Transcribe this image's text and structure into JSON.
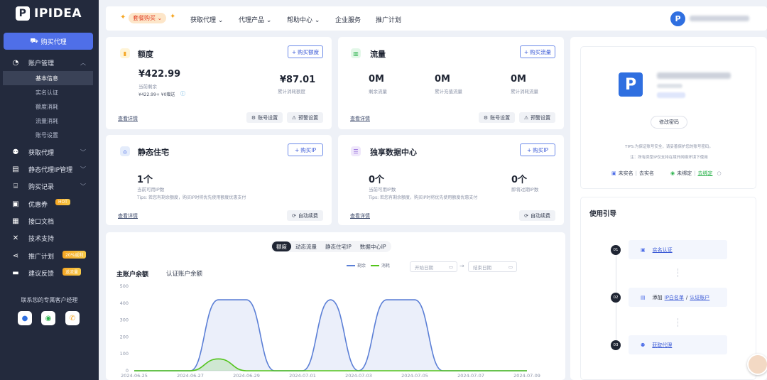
{
  "brand": {
    "name": "IPIDEA"
  },
  "sidebar": {
    "buy_label": "购买代理",
    "items": [
      {
        "label": "账户管理",
        "icon": "pie-chart-icon"
      },
      {
        "label": "获取代理",
        "icon": "user-download-icon"
      },
      {
        "label": "静态代理IP管理",
        "icon": "ticket-icon"
      },
      {
        "label": "购买记录",
        "icon": "gift-icon"
      },
      {
        "label": "优惠券",
        "icon": "coupon-icon",
        "badge": "HOT"
      },
      {
        "label": "接口文档",
        "icon": "doc-icon"
      },
      {
        "label": "技术支持",
        "icon": "wrench-icon"
      },
      {
        "label": "推广计划",
        "icon": "share-icon",
        "badge": "20%返利"
      },
      {
        "label": "建议反馈",
        "icon": "chat-icon",
        "badge": "送流量"
      }
    ],
    "subitems": [
      "基本信息",
      "实名认证",
      "额度消耗",
      "流量消耗",
      "账号设置"
    ],
    "manager_title": "联系您的专属客户经理"
  },
  "topbar": {
    "promo": "套餐购买",
    "nav": [
      "获取代理",
      "代理产品",
      "帮助中心",
      "企业服务",
      "推广计划"
    ]
  },
  "quota_card": {
    "title": "额度",
    "buy": "购买额度",
    "amount": "¥422.99",
    "amount_label": "当前剩余",
    "amount_detail": "¥422.99+ ¥0赠送",
    "consumed": "¥87.01",
    "consumed_label": "累计消耗额度",
    "details": "查看详情",
    "account_settings": "账号设置",
    "alert_settings": "预警设置"
  },
  "traffic_card": {
    "title": "流量",
    "buy": "购买流量",
    "values": [
      {
        "value": "0M",
        "label": "剩余流量"
      },
      {
        "value": "0M",
        "label": "累计充值流量"
      },
      {
        "value": "0M",
        "label": "累计消耗流量"
      }
    ],
    "details": "查看详情",
    "account_settings": "账号设置",
    "alert_settings": "预警设置"
  },
  "static_card": {
    "title": "静态住宅",
    "buy": "购买IP",
    "count": "1个",
    "count_label": "当前可用IP数",
    "tips": "Tips: 若您有剩余额度，购买IP时将优先使用额度优惠支付",
    "details": "查看详情",
    "auto_renew": "自动续费"
  },
  "dc_card": {
    "title": "独享数据中心",
    "buy": "购买IP",
    "count": "0个",
    "count_label": "当前可用IP数",
    "expiring": "0个",
    "expiring_label": "即将过期IP数",
    "tips": "Tips: 若您有剩余额度，购买IP时将优先使用额度优惠支付",
    "details": "查看详情",
    "auto_renew": "自动续费"
  },
  "chart_panel": {
    "tabs": [
      "额度",
      "动态流量",
      "静态住宅IP",
      "数据中心IP"
    ],
    "active_tab": "额度",
    "subtabs": [
      "主账户余额",
      "认证账户余额"
    ],
    "start_date": "开始日期",
    "end_date": "结束日期"
  },
  "chart_data": {
    "type": "area",
    "x": [
      "2024-06-25",
      "2024-06-26",
      "2024-06-27",
      "2024-06-28",
      "2024-06-29",
      "2024-06-30",
      "2024-07-01",
      "2024-07-02",
      "2024-07-03",
      "2024-07-04",
      "2024-07-05",
      "2024-07-06",
      "2024-07-07",
      "2024-07-08",
      "2024-07-09"
    ],
    "x_ticks": [
      "2024-06-25",
      "2024-06-27",
      "2024-06-29",
      "2024-07-01",
      "2024-07-03",
      "2024-07-05",
      "2024-07-07",
      "2024-07-09"
    ],
    "ylim": [
      0,
      500
    ],
    "yticks": [
      0,
      100,
      200,
      300,
      400,
      500
    ],
    "series": [
      {
        "name": "剩余",
        "color": "#5b7fd6",
        "values": [
          0,
          0,
          0,
          420,
          420,
          0,
          0,
          420,
          0,
          420,
          420,
          0,
          0,
          0,
          0
        ]
      },
      {
        "name": "消耗",
        "color": "#52c41a",
        "values": [
          0,
          0,
          0,
          70,
          0,
          0,
          0,
          0,
          0,
          0,
          0,
          0,
          0,
          0,
          0
        ]
      }
    ],
    "legend": "top-right"
  },
  "profile": {
    "edit_password": "修改密码",
    "tips": "TIPS:为保证账号安全，请妥善保护您的账号密码。",
    "note": "注：所有类型IP仅支持在境外网络环境下使用",
    "unverified": "未实名",
    "go_verify": "去实名",
    "unbound": "未绑定",
    "go_bind": "去绑定"
  },
  "guide": {
    "title": "使用引导",
    "steps": [
      {
        "num": "01",
        "text": "实名认证"
      },
      {
        "num": "02",
        "prefix": "添加",
        "link1": "IP白名单",
        "sep": "/",
        "link2": "认证账户"
      },
      {
        "num": "03",
        "text": "获取代理"
      }
    ]
  },
  "colors": {
    "sidebar": "#232a3d",
    "accent": "#4f6fe8",
    "series_remaining": "#5b7fd6",
    "series_consumed": "#52c41a"
  }
}
